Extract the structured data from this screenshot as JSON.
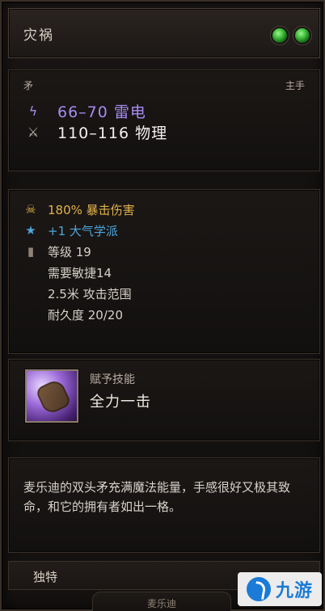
{
  "item": {
    "name": "灾祸",
    "slot_left": "矛",
    "slot_right": "主手",
    "damage": [
      {
        "icon": "lightning-icon",
        "text": "66–70 雷电",
        "color": "#a78bf0"
      },
      {
        "icon": "crossed-swords-icon",
        "text": "110–116 物理",
        "color": "#f2f0ee"
      }
    ],
    "stats": [
      {
        "icon": "skull-icon",
        "text": "180% 暴击伤害",
        "color": "#e2b24a"
      },
      {
        "icon": "star-icon",
        "text": "+1 大气学派",
        "color": "#4ea6dc"
      },
      {
        "icon": "bookmark-icon",
        "text": "等级 19",
        "color": "#d6d0c8"
      },
      {
        "icon": "",
        "text": "需要敏捷14",
        "color": "#d6d0c8"
      },
      {
        "icon": "",
        "text": "2.5米 攻击范围",
        "color": "#d6d0c8"
      },
      {
        "icon": "",
        "text": "耐久度 20/20",
        "color": "#d6d0c8"
      }
    ],
    "skill": {
      "label": "赋予技能",
      "name": "全力一击",
      "icon": "fist-strike-icon"
    },
    "description": "麦乐迪的双头矛充满魔法能量，手感很好又极其致命，和它的拥有者如出一格。",
    "rarity": "独特",
    "owner": "麦乐迪"
  },
  "watermark": {
    "text": "九游",
    "icon": "jiuyou-logo-icon"
  }
}
